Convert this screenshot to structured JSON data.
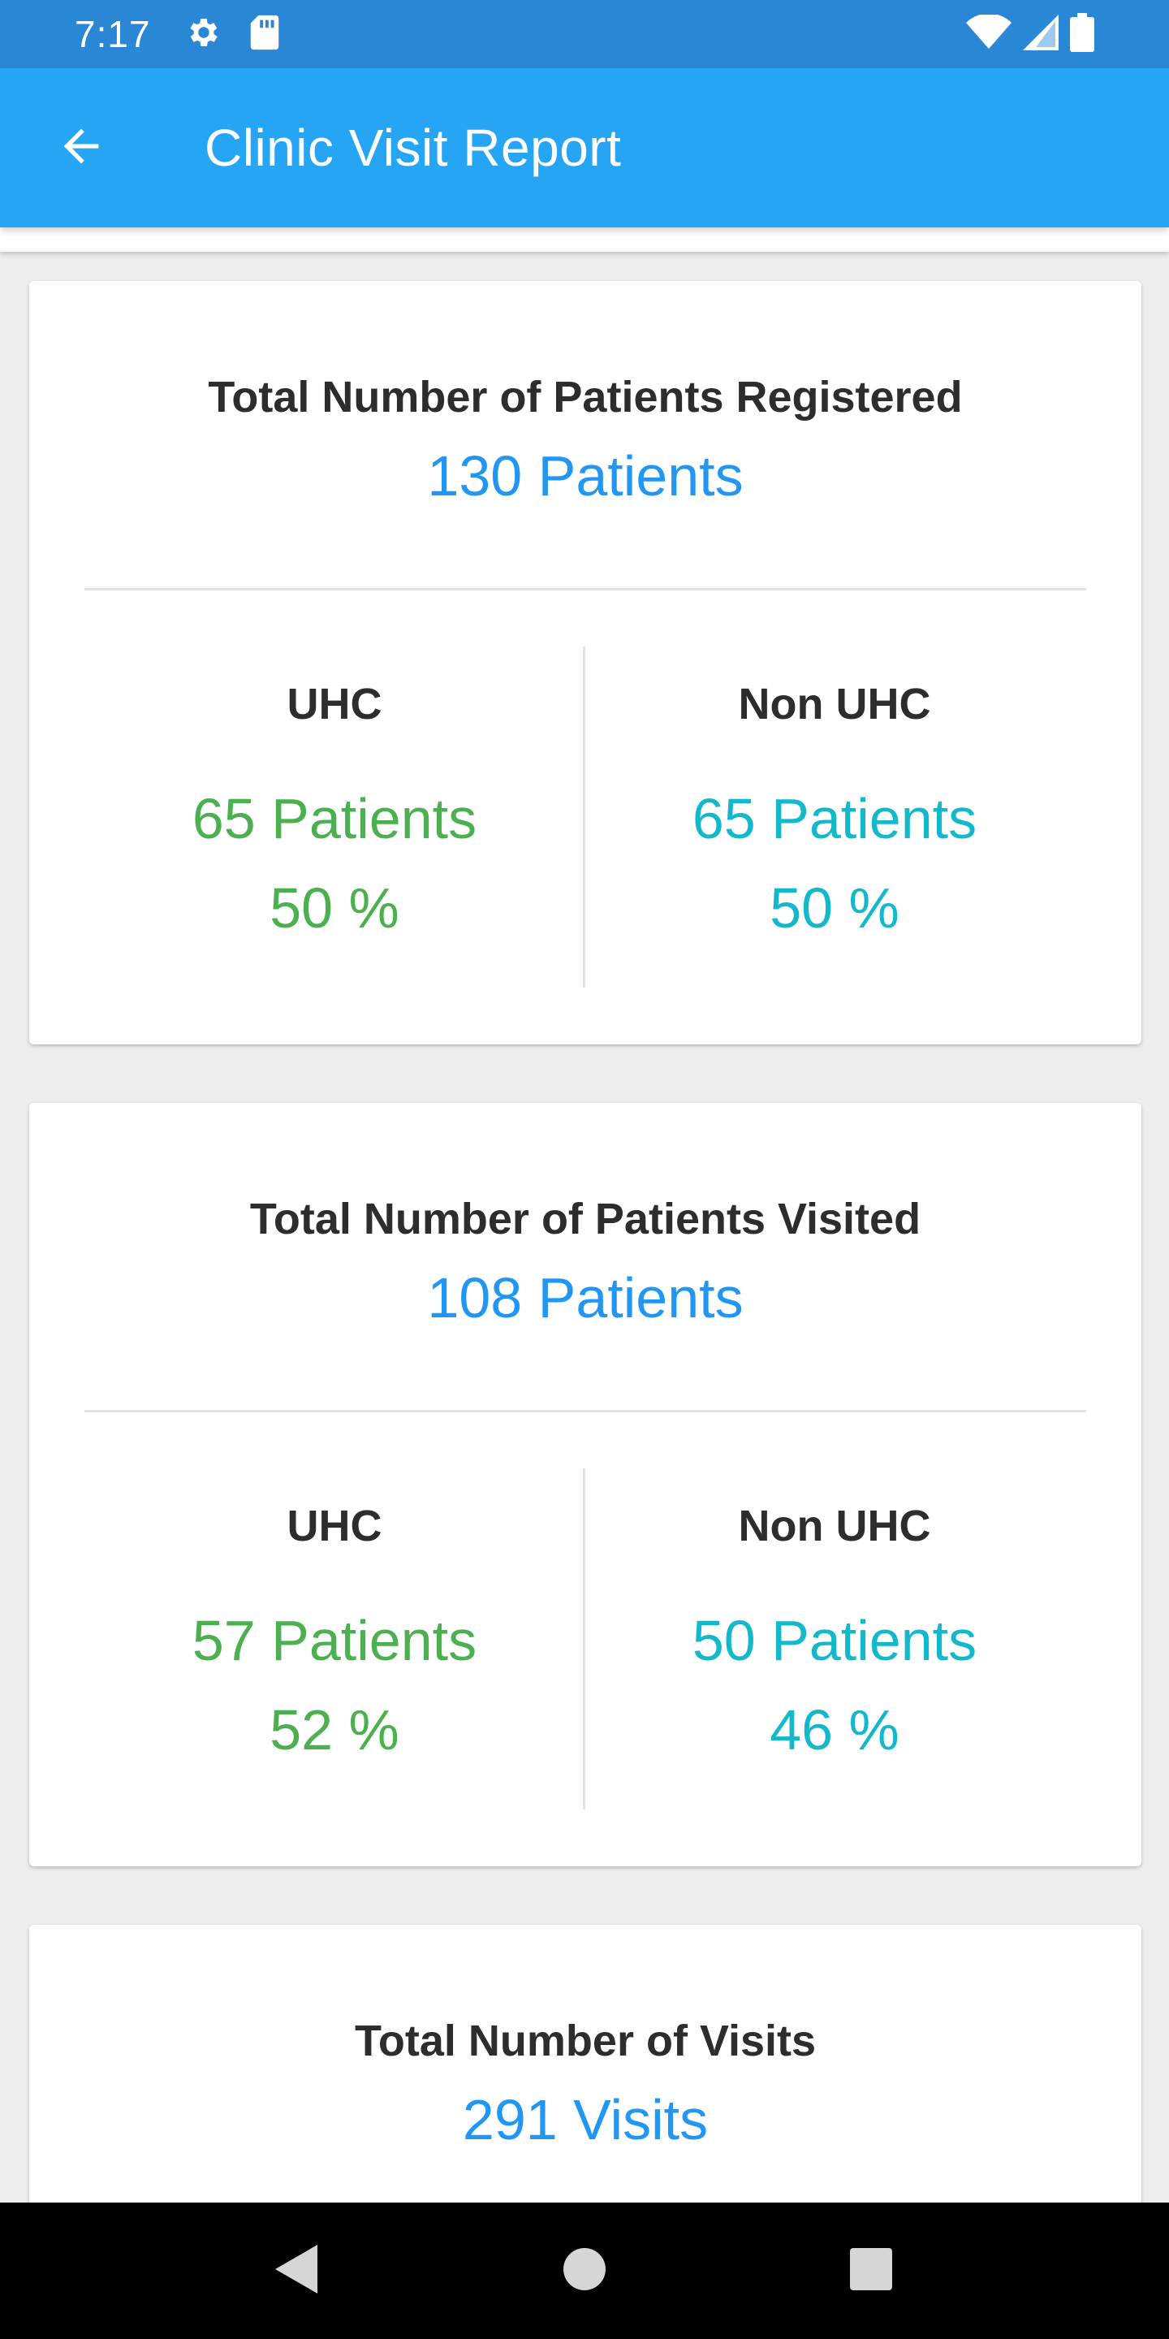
{
  "status_bar": {
    "time": "7:17"
  },
  "app_bar": {
    "title": "Clinic Visit Report"
  },
  "colors": {
    "app_bar": "#25a5f3",
    "status_bar": "#2a87d6",
    "total": "#2196f3",
    "uhc": "#4caf50",
    "non_uhc": "#14b8cb"
  },
  "cards": [
    {
      "title": "Total Number of Patients Registered",
      "total": "130 Patients",
      "uhc": {
        "label": "UHC",
        "count": "65 Patients",
        "percent": "50 %"
      },
      "non_uhc": {
        "label": "Non UHC",
        "count": "65 Patients",
        "percent": "50 %"
      }
    },
    {
      "title": "Total Number of Patients Visited",
      "total": "108 Patients",
      "uhc": {
        "label": "UHC",
        "count": "57 Patients",
        "percent": "52 %"
      },
      "non_uhc": {
        "label": "Non UHC",
        "count": "50 Patients",
        "percent": "46 %"
      }
    },
    {
      "title": "Total Number of Visits",
      "total": "291 Visits"
    }
  ]
}
